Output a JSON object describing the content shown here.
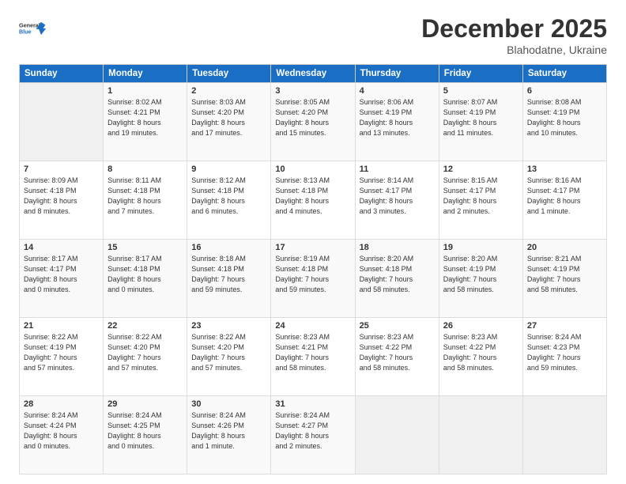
{
  "logo": {
    "line1": "General",
    "line2": "Blue"
  },
  "title": "December 2025",
  "location": "Blahodatne, Ukraine",
  "days_header": [
    "Sunday",
    "Monday",
    "Tuesday",
    "Wednesday",
    "Thursday",
    "Friday",
    "Saturday"
  ],
  "weeks": [
    [
      {
        "num": "",
        "detail": ""
      },
      {
        "num": "1",
        "detail": "Sunrise: 8:02 AM\nSunset: 4:21 PM\nDaylight: 8 hours\nand 19 minutes."
      },
      {
        "num": "2",
        "detail": "Sunrise: 8:03 AM\nSunset: 4:20 PM\nDaylight: 8 hours\nand 17 minutes."
      },
      {
        "num": "3",
        "detail": "Sunrise: 8:05 AM\nSunset: 4:20 PM\nDaylight: 8 hours\nand 15 minutes."
      },
      {
        "num": "4",
        "detail": "Sunrise: 8:06 AM\nSunset: 4:19 PM\nDaylight: 8 hours\nand 13 minutes."
      },
      {
        "num": "5",
        "detail": "Sunrise: 8:07 AM\nSunset: 4:19 PM\nDaylight: 8 hours\nand 11 minutes."
      },
      {
        "num": "6",
        "detail": "Sunrise: 8:08 AM\nSunset: 4:19 PM\nDaylight: 8 hours\nand 10 minutes."
      }
    ],
    [
      {
        "num": "7",
        "detail": "Sunrise: 8:09 AM\nSunset: 4:18 PM\nDaylight: 8 hours\nand 8 minutes."
      },
      {
        "num": "8",
        "detail": "Sunrise: 8:11 AM\nSunset: 4:18 PM\nDaylight: 8 hours\nand 7 minutes."
      },
      {
        "num": "9",
        "detail": "Sunrise: 8:12 AM\nSunset: 4:18 PM\nDaylight: 8 hours\nand 6 minutes."
      },
      {
        "num": "10",
        "detail": "Sunrise: 8:13 AM\nSunset: 4:18 PM\nDaylight: 8 hours\nand 4 minutes."
      },
      {
        "num": "11",
        "detail": "Sunrise: 8:14 AM\nSunset: 4:17 PM\nDaylight: 8 hours\nand 3 minutes."
      },
      {
        "num": "12",
        "detail": "Sunrise: 8:15 AM\nSunset: 4:17 PM\nDaylight: 8 hours\nand 2 minutes."
      },
      {
        "num": "13",
        "detail": "Sunrise: 8:16 AM\nSunset: 4:17 PM\nDaylight: 8 hours\nand 1 minute."
      }
    ],
    [
      {
        "num": "14",
        "detail": "Sunrise: 8:17 AM\nSunset: 4:17 PM\nDaylight: 8 hours\nand 0 minutes."
      },
      {
        "num": "15",
        "detail": "Sunrise: 8:17 AM\nSunset: 4:18 PM\nDaylight: 8 hours\nand 0 minutes."
      },
      {
        "num": "16",
        "detail": "Sunrise: 8:18 AM\nSunset: 4:18 PM\nDaylight: 7 hours\nand 59 minutes."
      },
      {
        "num": "17",
        "detail": "Sunrise: 8:19 AM\nSunset: 4:18 PM\nDaylight: 7 hours\nand 59 minutes."
      },
      {
        "num": "18",
        "detail": "Sunrise: 8:20 AM\nSunset: 4:18 PM\nDaylight: 7 hours\nand 58 minutes."
      },
      {
        "num": "19",
        "detail": "Sunrise: 8:20 AM\nSunset: 4:19 PM\nDaylight: 7 hours\nand 58 minutes."
      },
      {
        "num": "20",
        "detail": "Sunrise: 8:21 AM\nSunset: 4:19 PM\nDaylight: 7 hours\nand 58 minutes."
      }
    ],
    [
      {
        "num": "21",
        "detail": "Sunrise: 8:22 AM\nSunset: 4:19 PM\nDaylight: 7 hours\nand 57 minutes."
      },
      {
        "num": "22",
        "detail": "Sunrise: 8:22 AM\nSunset: 4:20 PM\nDaylight: 7 hours\nand 57 minutes."
      },
      {
        "num": "23",
        "detail": "Sunrise: 8:22 AM\nSunset: 4:20 PM\nDaylight: 7 hours\nand 57 minutes."
      },
      {
        "num": "24",
        "detail": "Sunrise: 8:23 AM\nSunset: 4:21 PM\nDaylight: 7 hours\nand 58 minutes."
      },
      {
        "num": "25",
        "detail": "Sunrise: 8:23 AM\nSunset: 4:22 PM\nDaylight: 7 hours\nand 58 minutes."
      },
      {
        "num": "26",
        "detail": "Sunrise: 8:23 AM\nSunset: 4:22 PM\nDaylight: 7 hours\nand 58 minutes."
      },
      {
        "num": "27",
        "detail": "Sunrise: 8:24 AM\nSunset: 4:23 PM\nDaylight: 7 hours\nand 59 minutes."
      }
    ],
    [
      {
        "num": "28",
        "detail": "Sunrise: 8:24 AM\nSunset: 4:24 PM\nDaylight: 8 hours\nand 0 minutes."
      },
      {
        "num": "29",
        "detail": "Sunrise: 8:24 AM\nSunset: 4:25 PM\nDaylight: 8 hours\nand 0 minutes."
      },
      {
        "num": "30",
        "detail": "Sunrise: 8:24 AM\nSunset: 4:26 PM\nDaylight: 8 hours\nand 1 minute."
      },
      {
        "num": "31",
        "detail": "Sunrise: 8:24 AM\nSunset: 4:27 PM\nDaylight: 8 hours\nand 2 minutes."
      },
      {
        "num": "",
        "detail": ""
      },
      {
        "num": "",
        "detail": ""
      },
      {
        "num": "",
        "detail": ""
      }
    ]
  ]
}
